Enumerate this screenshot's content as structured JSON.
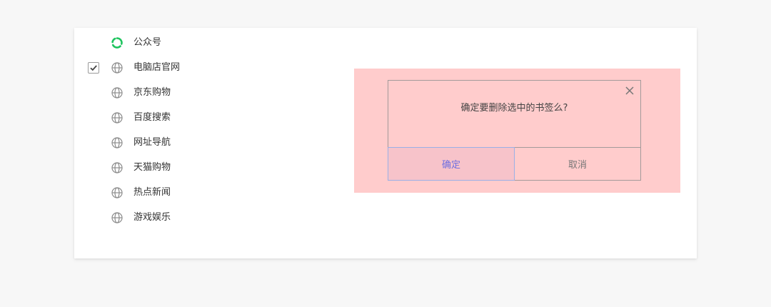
{
  "bookmarks": [
    {
      "label": "公众号",
      "icon": "wechat-official-icon",
      "checked": false
    },
    {
      "label": "电脑店官网",
      "icon": "globe-icon",
      "checked": true
    },
    {
      "label": "京东购物",
      "icon": "globe-icon",
      "checked": false
    },
    {
      "label": "百度搜索",
      "icon": "globe-icon",
      "checked": false
    },
    {
      "label": "网址导航",
      "icon": "globe-icon",
      "checked": false
    },
    {
      "label": "天猫购物",
      "icon": "globe-icon",
      "checked": false
    },
    {
      "label": "热点新闻",
      "icon": "globe-icon",
      "checked": false
    },
    {
      "label": "游戏娱乐",
      "icon": "globe-icon",
      "checked": false
    }
  ],
  "dialog": {
    "message": "确定要删除选中的书签么?",
    "confirm_label": "确定",
    "cancel_label": "取消"
  },
  "colors": {
    "overlay": "#ffcccc",
    "confirm_text": "#6f6fe0",
    "wechat_green": "#1fc45f",
    "globe_gray": "#8c8c8c"
  }
}
